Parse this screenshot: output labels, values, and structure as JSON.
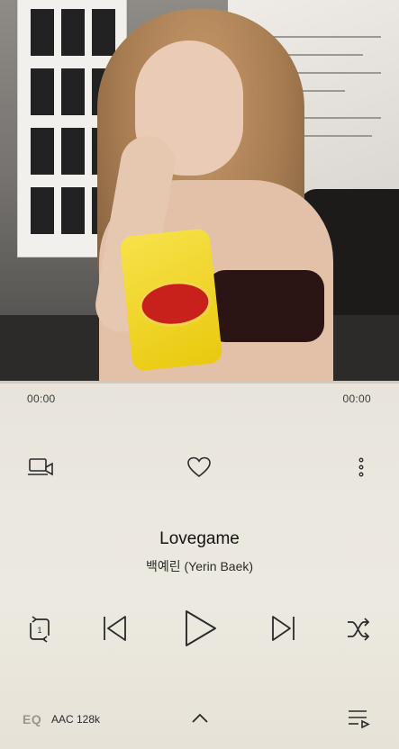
{
  "track": {
    "title": "Lovegame",
    "artist": "백예린 (Yerin Baek)",
    "elapsed": "00:00",
    "duration": "00:00",
    "progress": 0.0
  },
  "actions": {
    "cast_icon": "cast-icon",
    "like_icon": "heart-icon",
    "more_icon": "more-vertical-icon"
  },
  "controls": {
    "repeat_icon": "repeat-one-icon",
    "previous_icon": "skip-previous-icon",
    "play_icon": "play-icon",
    "next_icon": "skip-next-icon",
    "shuffle_icon": "shuffle-icon",
    "repeat_badge": "1"
  },
  "footer": {
    "eq_label": "EQ",
    "codec": "AAC 128k",
    "expand_icon": "chevron-up-icon",
    "queue_icon": "playlist-icon"
  },
  "colors": {
    "background": "#ebe8e0",
    "icon": "#2a2a2a",
    "progress_track": "#cfcac1"
  }
}
